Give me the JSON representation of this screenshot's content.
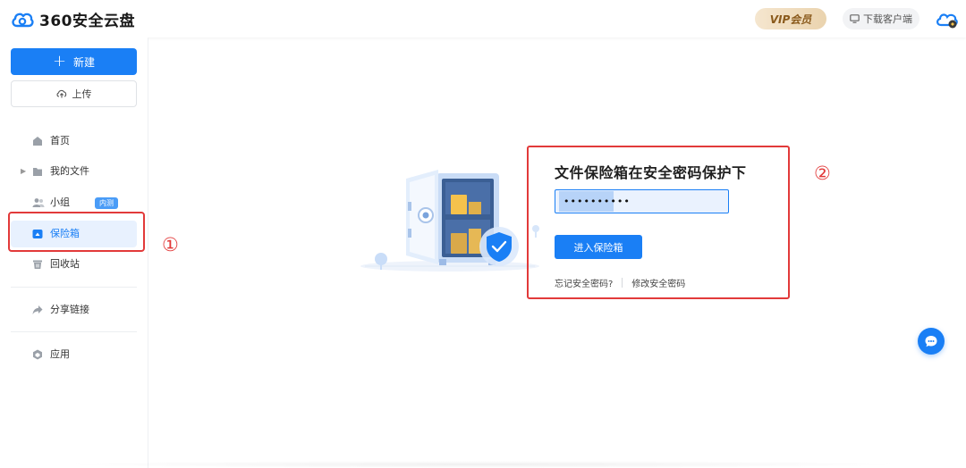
{
  "app": {
    "logo_text": "360安全云盘",
    "brand_color": "#1a7ff5",
    "icons": {
      "logo": "cloud-logo-icon",
      "download": "monitor-icon",
      "avatar": "cloud-avatar-icon",
      "chat": "chat-bubble-icon"
    }
  },
  "header": {
    "vip_label": "VIP会员",
    "download_label": "下载客户端"
  },
  "sidebar": {
    "new_label": "新建",
    "upload_label": "上传",
    "items": [
      {
        "label": "首页",
        "icon": "home-icon"
      },
      {
        "label": "我的文件",
        "icon": "folder-icon",
        "expandable": true
      },
      {
        "label": "小组",
        "icon": "group-icon",
        "badge": "内测"
      },
      {
        "label": "保险箱",
        "icon": "safe-icon",
        "active": true
      },
      {
        "label": "回收站",
        "icon": "trash-icon"
      },
      {
        "label": "分享链接",
        "icon": "share-icon"
      },
      {
        "label": "应用",
        "icon": "app-icon"
      }
    ]
  },
  "annotations": {
    "marker_1": "①",
    "marker_2": "②",
    "highlight_color": "#e23a3a"
  },
  "vault": {
    "title": "文件保险箱在安全密码保护下",
    "password_value": "••••••••••",
    "enter_label": "进入保险箱",
    "forgot_label": "忘记安全密码?",
    "change_label": "修改安全密码"
  }
}
